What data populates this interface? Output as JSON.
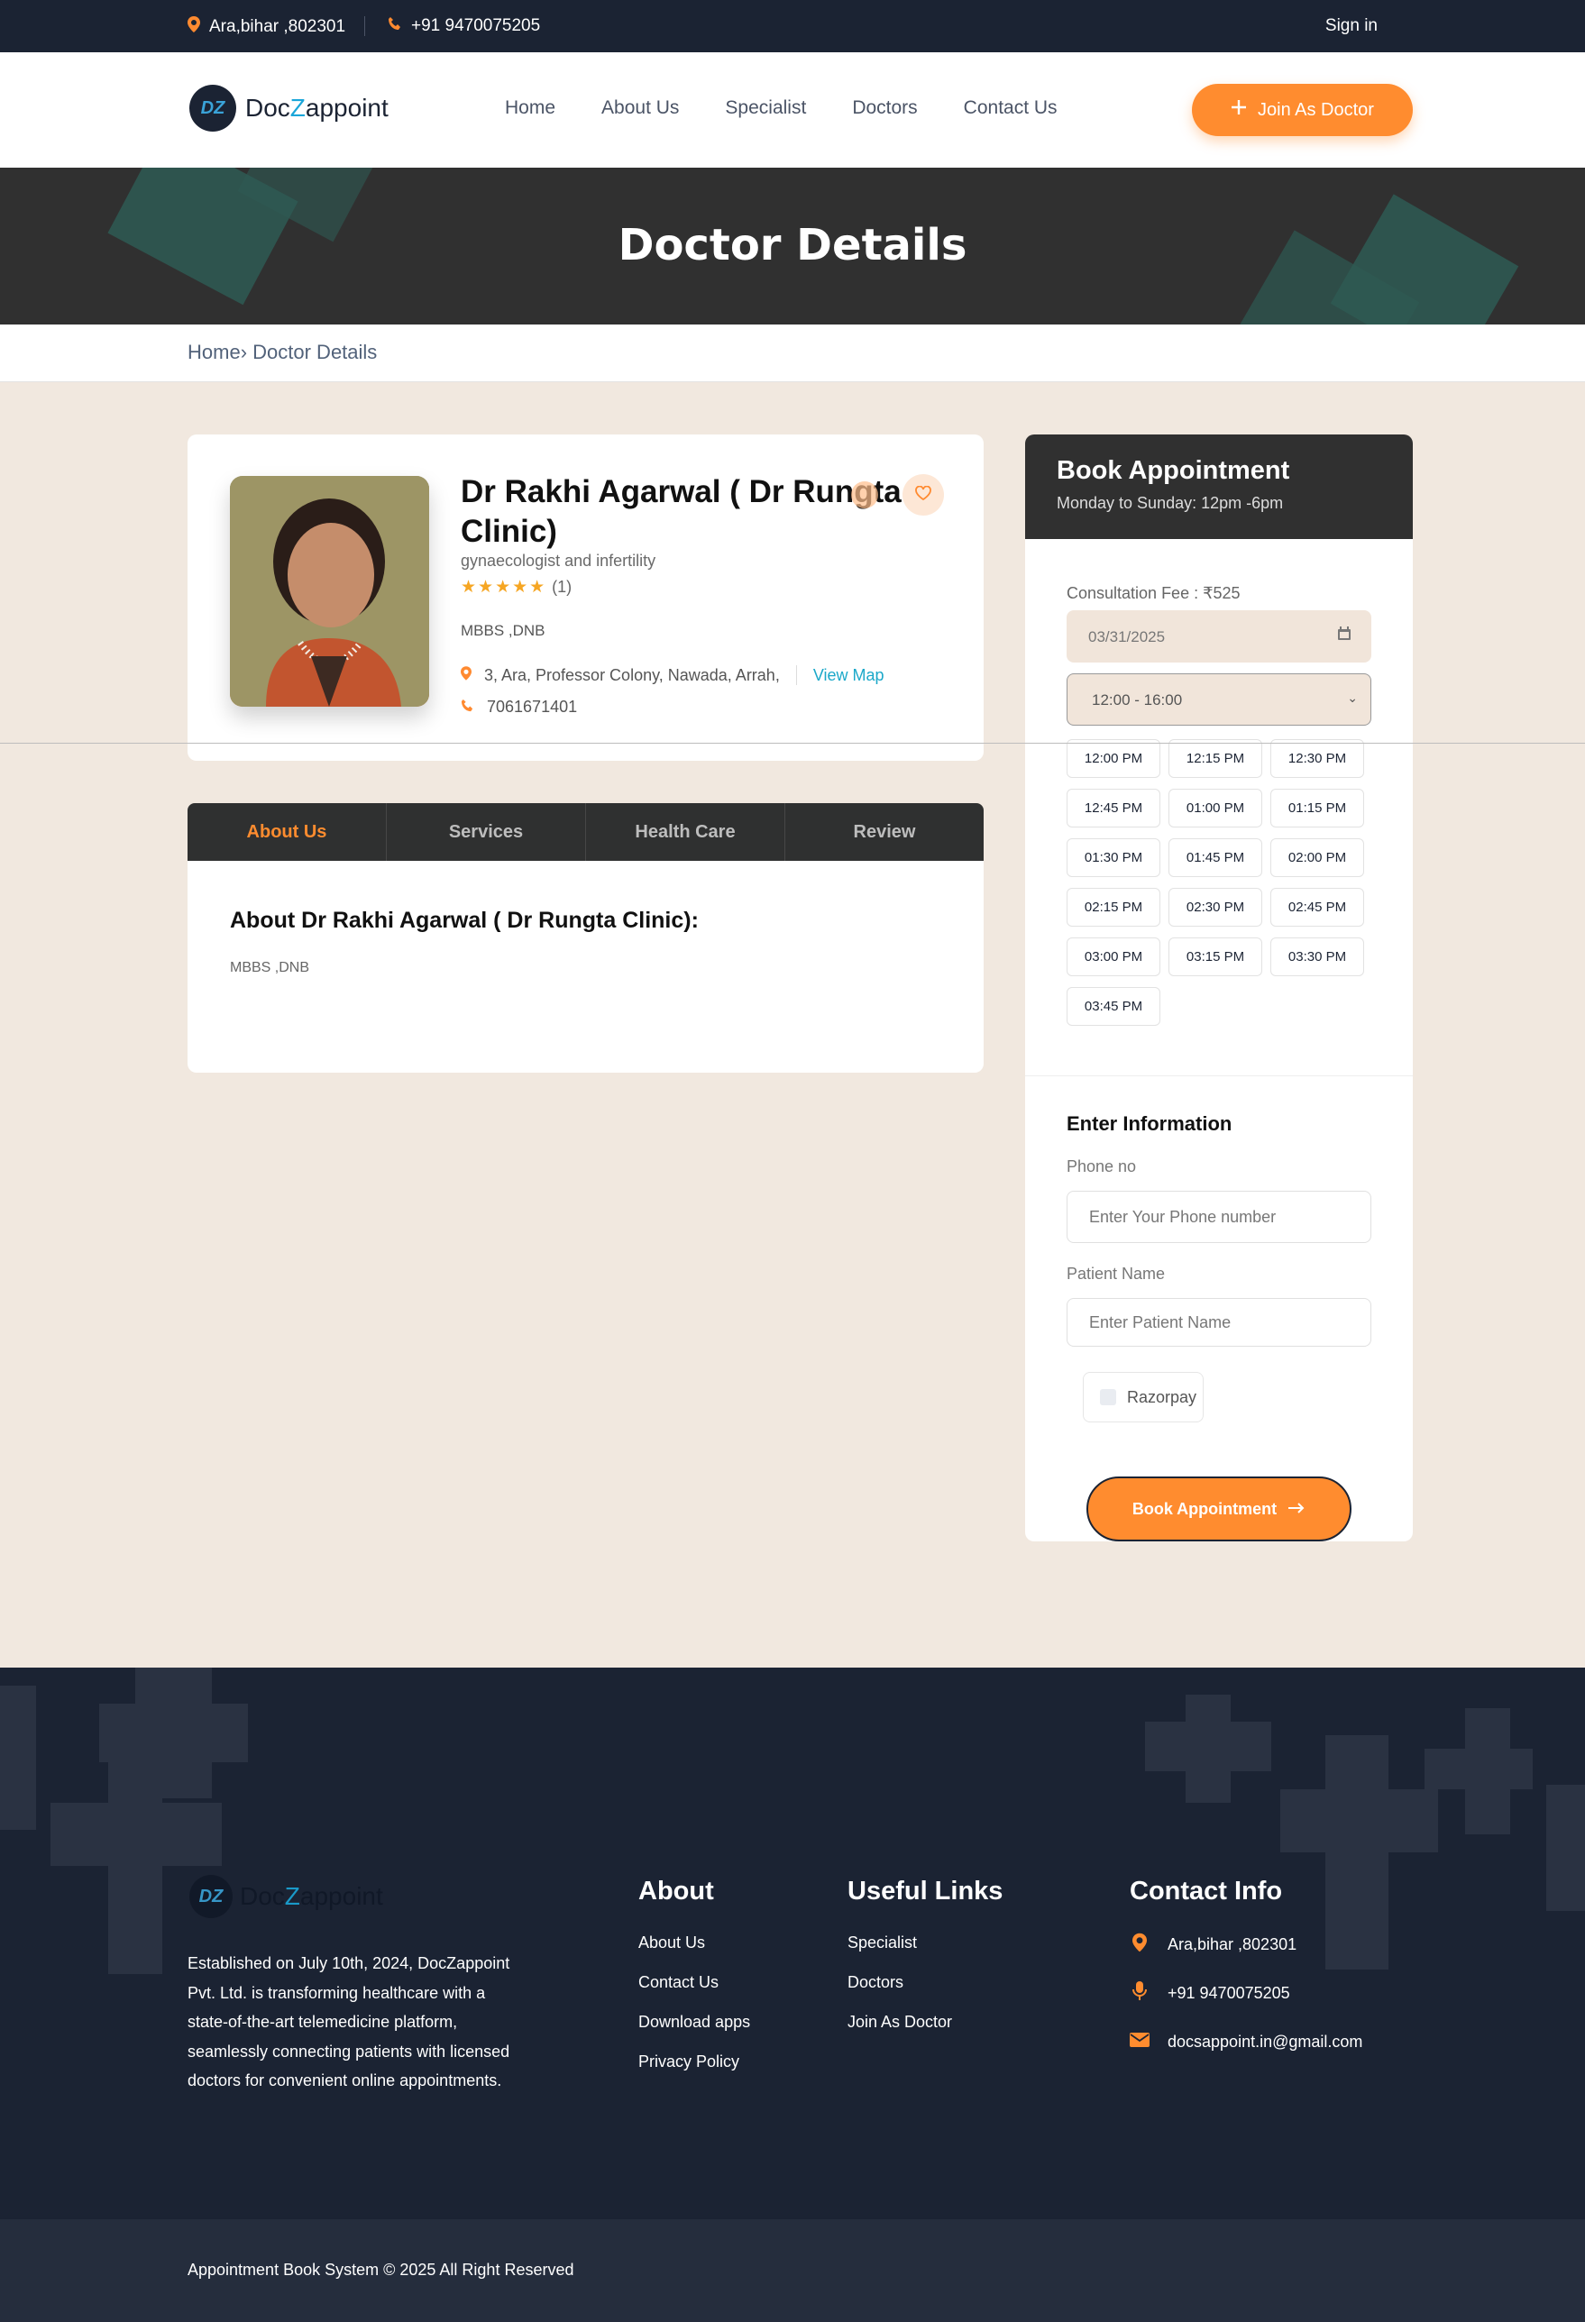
{
  "topbar": {
    "location": "Ara,bihar ,802301",
    "phone": "+91 9470075205",
    "signin": "Sign in"
  },
  "header": {
    "logo_mark": "DZ",
    "logo_pre": "Doc",
    "logo_z": "Z",
    "logo_post": "appoint",
    "nav": [
      "Home",
      "About Us",
      "Specialist",
      "Doctors",
      "Contact Us"
    ],
    "join_label": "Join As Doctor"
  },
  "banner": {
    "title": "Doctor Details"
  },
  "breadcrumb": {
    "home": "Home",
    "current": "Doctor Details"
  },
  "doctor": {
    "name": "Dr Rakhi Agarwal ( Dr Rungta Clinic)",
    "specialty": "gynaecologist and infertility",
    "stars": "★★★★★",
    "rating_count": "(1)",
    "degree": "MBBS ,DNB",
    "address": "3, Ara, Professor Colony, Nawada, Arrah,",
    "view_map": "View Map",
    "phone": "7061671401"
  },
  "tabs": [
    "About Us",
    "Services",
    "Health Care",
    "Review"
  ],
  "about": {
    "heading": "About Dr Rakhi Agarwal ( Dr Rungta Clinic):",
    "text": "MBBS ,DNB"
  },
  "booking": {
    "title": "Book Appointment",
    "hours": "Monday to Sunday: 12pm -6pm",
    "fee": "Consultation Fee : ₹525",
    "date": "03/31/2025",
    "time_range": "12:00 - 16:00",
    "slots": [
      "12:00 PM",
      "12:15 PM",
      "12:30 PM",
      "12:45 PM",
      "01:00 PM",
      "01:15 PM",
      "01:30 PM",
      "01:45 PM",
      "02:00 PM",
      "02:15 PM",
      "02:30 PM",
      "02:45 PM",
      "03:00 PM",
      "03:15 PM",
      "03:30 PM",
      "03:45 PM"
    ],
    "info_heading": "Enter Information",
    "phone_label": "Phone no",
    "phone_placeholder": "Enter Your Phone number",
    "patient_label": "Patient Name",
    "patient_placeholder": "Enter Patient Name",
    "payment": "Razorpay",
    "submit": "Book Appointment"
  },
  "footer": {
    "about_text": "Established on July 10th, 2024, DocZappoint Pvt. Ltd. is transforming healthcare with a state-of-the-art telemedicine platform, seamlessly connecting patients with licensed doctors for convenient online appointments.",
    "about_heading": "About",
    "about_links": [
      "About Us",
      "Contact Us",
      "Download apps",
      "Privacy Policy"
    ],
    "useful_heading": "Useful Links",
    "useful_links": [
      "Specialist",
      "Doctors",
      "Join As Doctor"
    ],
    "contact_heading": "Contact Info",
    "contact_address": "Ara,bihar ,802301",
    "contact_phone": "+91 9470075205",
    "contact_email": "docsappoint.in@gmail.com",
    "copyright": "Appointment Book System © 2025 All Right Reserved"
  },
  "colors": {
    "accent": "#ff8c2f",
    "dark": "#1b2333",
    "link": "#1ba8c9"
  }
}
